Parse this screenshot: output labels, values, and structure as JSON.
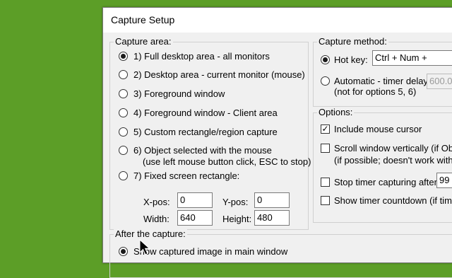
{
  "window": {
    "title": "Capture Setup"
  },
  "capture_area": {
    "label": "Capture area:",
    "options": [
      {
        "label": "1) Full desktop area - all monitors",
        "selected": true
      },
      {
        "label": "2) Desktop area - current monitor (mouse)",
        "selected": false
      },
      {
        "label": "3) Foreground window",
        "selected": false
      },
      {
        "label": "4) Foreground window - Client area",
        "selected": false
      },
      {
        "label": "5) Custom rectangle/region capture",
        "selected": false
      },
      {
        "label": "6) Object selected with the mouse",
        "sublabel": "(use left mouse button click, ESC to stop)",
        "selected": false
      },
      {
        "label": "7) Fixed screen rectangle:",
        "selected": false
      }
    ],
    "rect": {
      "xpos_label": "X-pos:",
      "xpos": "0",
      "ypos_label": "Y-pos:",
      "ypos": "0",
      "width_label": "Width:",
      "width": "640",
      "height_label": "Height:",
      "height": "480"
    }
  },
  "capture_method": {
    "label": "Capture method:",
    "hotkey_label": "Hot key:",
    "hotkey_value": "Ctrl + Num +",
    "hotkey_selected": true,
    "auto_label": "Automatic - timer delay:",
    "auto_sublabel": "(not for options 5, 6)",
    "auto_value": "600.0",
    "auto_selected": false
  },
  "options": {
    "label": "Options:",
    "include_cursor": {
      "label": "Include mouse cursor",
      "checked": true
    },
    "scroll_window": {
      "label": "Scroll window vertically (if Objec",
      "sublabel": "(if possible; doesn't work with a",
      "checked": false
    },
    "stop_timer": {
      "label": "Stop timer capturing after:",
      "value": "99",
      "checked": false
    },
    "show_countdown": {
      "label": "Show timer countdown (if timer",
      "checked": false
    }
  },
  "after_capture": {
    "label": "After the capture:",
    "option1": {
      "label": "Show captured image in main window",
      "selected": true
    }
  }
}
